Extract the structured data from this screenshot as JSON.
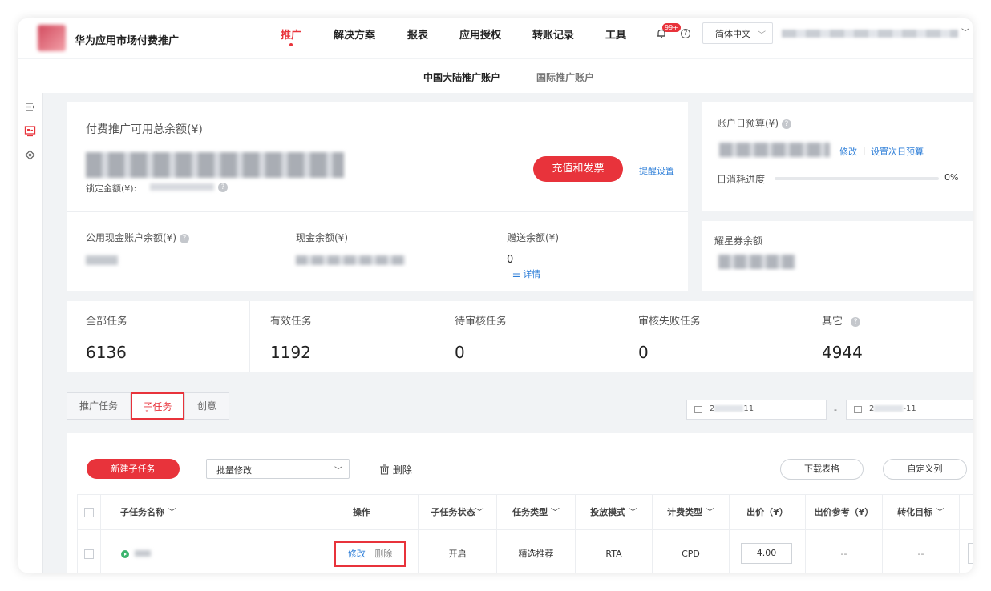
{
  "header": {
    "app_title": "华为应用市场付费推广",
    "nav": [
      "推广",
      "解决方案",
      "报表",
      "应用授权",
      "转账记录",
      "工具"
    ],
    "notification_badge": "99+",
    "help_glyph": "?",
    "language": "简体中文"
  },
  "account_tabs": {
    "active": "中国大陆推广账户",
    "inactive": "国际推广账户"
  },
  "balance_card": {
    "title": "付费推广可用总余额(¥)",
    "locked_label": "锁定金额(¥):",
    "recharge_button": "充值和发票",
    "reminder_link": "提醒设置"
  },
  "balance_breakdown": {
    "public_cash_label": "公用现金账户余额(¥)",
    "cash_label": "现金余额(¥)",
    "bonus_label": "赠送余额(¥)",
    "bonus_value": "0",
    "details_link": "详情"
  },
  "budget_card": {
    "title": "账户日预算(¥)",
    "modify_link": "修改",
    "next_day_link": "设置次日预算",
    "progress_label": "日消耗进度",
    "progress_value": "0%",
    "progress_fraction": 0
  },
  "coupon_card": {
    "title": "耀星券余额"
  },
  "stats": [
    {
      "label": "全部任务",
      "value": "6136"
    },
    {
      "label": "有效任务",
      "value": "1192"
    },
    {
      "label": "待审核任务",
      "value": "0"
    },
    {
      "label": "审核失败任务",
      "value": "0"
    },
    {
      "label": "其它",
      "value": "4944"
    }
  ],
  "task_tabs": [
    "推广任务",
    "子任务",
    "创意"
  ],
  "date_range": {
    "start_prefix": "2",
    "start_suffix": "11",
    "end_prefix": "2",
    "end_suffix": "-11",
    "separator": "-"
  },
  "toolbar": {
    "new_subtask": "新建子任务",
    "batch_modify": "批量修改",
    "delete": "删除",
    "download": "下载表格",
    "custom_columns": "自定义列"
  },
  "table": {
    "headers": [
      "子任务名称",
      "操作",
      "子任务状态",
      "任务类型",
      "投放模式",
      "计费类型",
      "出价（¥）",
      "出价参考（¥）",
      "转化目标"
    ],
    "row": {
      "edit": "修改",
      "delete": "删除",
      "status": "开启",
      "task_type": "精选推荐",
      "delivery_mode": "RTA",
      "billing_type": "CPD",
      "bid": "4.00",
      "bid_reference": "--",
      "conversion_target": "--"
    }
  },
  "colors": {
    "accent": "#e8333b",
    "link": "#2f7fd8"
  }
}
